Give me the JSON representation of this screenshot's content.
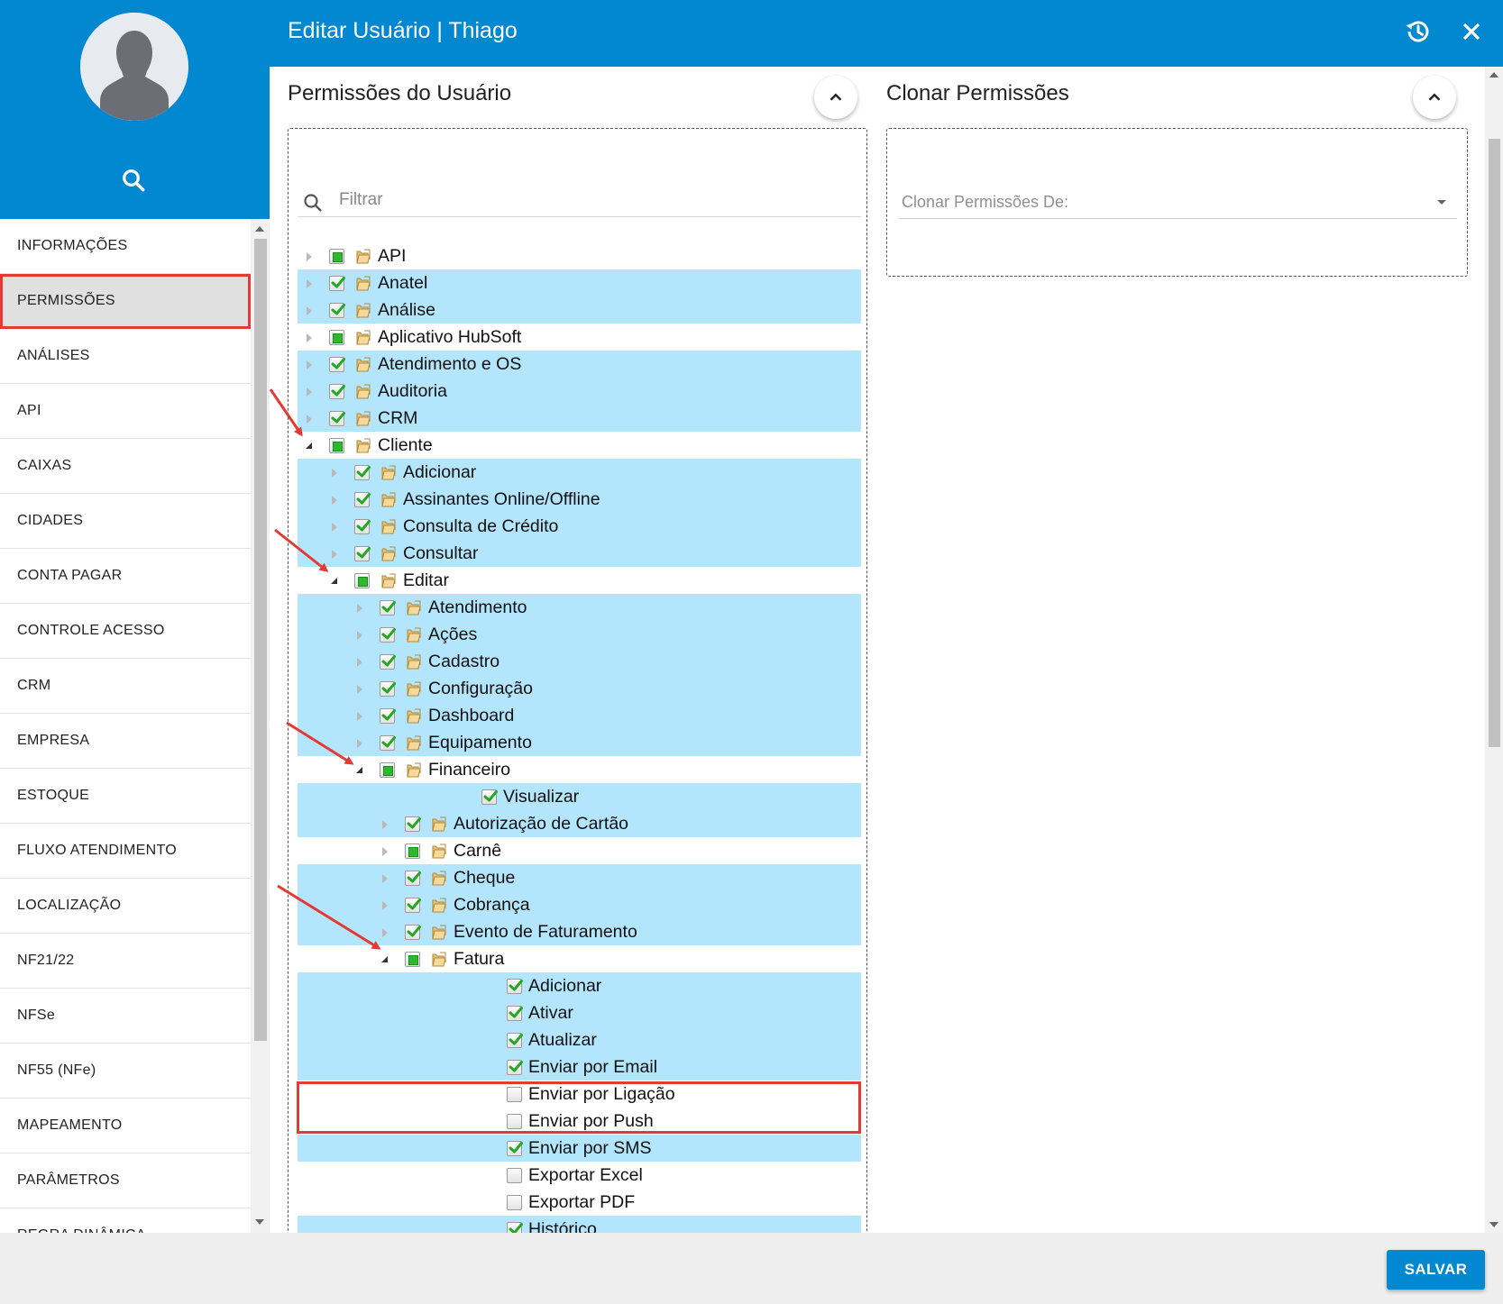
{
  "header": {
    "title": "Editar Usuário | Thiago"
  },
  "sidebar": {
    "items": [
      {
        "label": "INFORMAÇÕES",
        "active": false
      },
      {
        "label": "PERMISSÕES",
        "active": true
      },
      {
        "label": "ANÁLISES",
        "active": false
      },
      {
        "label": "API",
        "active": false
      },
      {
        "label": "CAIXAS",
        "active": false
      },
      {
        "label": "CIDADES",
        "active": false
      },
      {
        "label": "CONTA PAGAR",
        "active": false
      },
      {
        "label": "CONTROLE ACESSO",
        "active": false
      },
      {
        "label": "CRM",
        "active": false
      },
      {
        "label": "EMPRESA",
        "active": false
      },
      {
        "label": "ESTOQUE",
        "active": false
      },
      {
        "label": "FLUXO ATENDIMENTO",
        "active": false
      },
      {
        "label": "LOCALIZAÇÃO",
        "active": false
      },
      {
        "label": "NF21/22",
        "active": false
      },
      {
        "label": "NFSe",
        "active": false
      },
      {
        "label": "NF55 (NFe)",
        "active": false
      },
      {
        "label": "MAPEAMENTO",
        "active": false
      },
      {
        "label": "PARÂMETROS",
        "active": false
      },
      {
        "label": "REGRA DINÂMICA",
        "active": false
      }
    ]
  },
  "permissions": {
    "title": "Permissões do Usuário",
    "filter_placeholder": "Filtrar",
    "tree": [
      {
        "label": "API",
        "level": 0,
        "toggle": "closed",
        "check": "partial",
        "folder": true,
        "highlight": false
      },
      {
        "label": "Anatel",
        "level": 0,
        "toggle": "closed",
        "check": "checked",
        "folder": true,
        "highlight": true
      },
      {
        "label": "Análise",
        "level": 0,
        "toggle": "closed",
        "check": "checked",
        "folder": true,
        "highlight": true
      },
      {
        "label": "Aplicativo HubSoft",
        "level": 0,
        "toggle": "closed",
        "check": "partial",
        "folder": true,
        "highlight": false
      },
      {
        "label": "Atendimento e OS",
        "level": 0,
        "toggle": "closed",
        "check": "checked",
        "folder": true,
        "highlight": true
      },
      {
        "label": "Auditoria",
        "level": 0,
        "toggle": "closed",
        "check": "checked",
        "folder": true,
        "highlight": true
      },
      {
        "label": "CRM",
        "level": 0,
        "toggle": "closed",
        "check": "checked",
        "folder": true,
        "highlight": true
      },
      {
        "label": "Cliente",
        "level": 0,
        "toggle": "open",
        "check": "partial",
        "folder": true,
        "highlight": false
      },
      {
        "label": "Adicionar",
        "level": 1,
        "toggle": "closed",
        "check": "checked",
        "folder": true,
        "highlight": true
      },
      {
        "label": "Assinantes Online/Offline",
        "level": 1,
        "toggle": "closed",
        "check": "checked",
        "folder": true,
        "highlight": true
      },
      {
        "label": "Consulta de Crédito",
        "level": 1,
        "toggle": "closed",
        "check": "checked",
        "folder": true,
        "highlight": true
      },
      {
        "label": "Consultar",
        "level": 1,
        "toggle": "closed",
        "check": "checked",
        "folder": true,
        "highlight": true
      },
      {
        "label": "Editar",
        "level": 1,
        "toggle": "open",
        "check": "partial",
        "folder": true,
        "highlight": false
      },
      {
        "label": "Atendimento",
        "level": 2,
        "toggle": "closed",
        "check": "checked",
        "folder": true,
        "highlight": true
      },
      {
        "label": "Ações",
        "level": 2,
        "toggle": "closed",
        "check": "checked",
        "folder": true,
        "highlight": true
      },
      {
        "label": "Cadastro",
        "level": 2,
        "toggle": "closed",
        "check": "checked",
        "folder": true,
        "highlight": true
      },
      {
        "label": "Configuração",
        "level": 2,
        "toggle": "closed",
        "check": "checked",
        "folder": true,
        "highlight": true
      },
      {
        "label": "Dashboard",
        "level": 2,
        "toggle": "closed",
        "check": "checked",
        "folder": true,
        "highlight": true
      },
      {
        "label": "Equipamento",
        "level": 2,
        "toggle": "closed",
        "check": "checked",
        "folder": true,
        "highlight": true
      },
      {
        "label": "Financeiro",
        "level": 2,
        "toggle": "open",
        "check": "partial",
        "folder": true,
        "highlight": false
      },
      {
        "label": "Visualizar",
        "level": 3,
        "toggle": "none",
        "check": "checked",
        "folder": false,
        "highlight": true
      },
      {
        "label": "Autorização de Cartão",
        "level": 3,
        "toggle": "closed",
        "check": "checked",
        "folder": true,
        "highlight": true
      },
      {
        "label": "Carnê",
        "level": 3,
        "toggle": "closed",
        "check": "partial",
        "folder": true,
        "highlight": false
      },
      {
        "label": "Cheque",
        "level": 3,
        "toggle": "closed",
        "check": "checked",
        "folder": true,
        "highlight": true
      },
      {
        "label": "Cobrança",
        "level": 3,
        "toggle": "closed",
        "check": "checked",
        "folder": true,
        "highlight": true
      },
      {
        "label": "Evento de Faturamento",
        "level": 3,
        "toggle": "closed",
        "check": "checked",
        "folder": true,
        "highlight": true
      },
      {
        "label": "Fatura",
        "level": 3,
        "toggle": "open",
        "check": "partial",
        "folder": true,
        "highlight": false
      },
      {
        "label": "Adicionar",
        "level": 4,
        "toggle": "none",
        "check": "checked",
        "folder": false,
        "highlight": true
      },
      {
        "label": "Ativar",
        "level": 4,
        "toggle": "none",
        "check": "checked",
        "folder": false,
        "highlight": true
      },
      {
        "label": "Atualizar",
        "level": 4,
        "toggle": "none",
        "check": "checked",
        "folder": false,
        "highlight": true
      },
      {
        "label": "Enviar por Email",
        "level": 4,
        "toggle": "none",
        "check": "checked",
        "folder": false,
        "highlight": true
      },
      {
        "label": "Enviar por Ligação",
        "level": 4,
        "toggle": "none",
        "check": "unchecked",
        "folder": false,
        "highlight": false
      },
      {
        "label": "Enviar por Push",
        "level": 4,
        "toggle": "none",
        "check": "unchecked",
        "folder": false,
        "highlight": false
      },
      {
        "label": "Enviar por SMS",
        "level": 4,
        "toggle": "none",
        "check": "checked",
        "folder": false,
        "highlight": true
      },
      {
        "label": "Exportar Excel",
        "level": 4,
        "toggle": "none",
        "check": "unchecked",
        "folder": false,
        "highlight": false
      },
      {
        "label": "Exportar PDF",
        "level": 4,
        "toggle": "none",
        "check": "unchecked",
        "folder": false,
        "highlight": false
      },
      {
        "label": "Histórico",
        "level": 4,
        "toggle": "none",
        "check": "checked",
        "folder": false,
        "highlight": true
      }
    ]
  },
  "clone": {
    "title": "Clonar Permissões",
    "select_label": "Clonar Permissões De:"
  },
  "footer": {
    "save_label": "SALVAR"
  },
  "colors": {
    "primary": "#0288d1",
    "row_highlight": "#b3e5fc",
    "check_green": "#2db82d",
    "annotation_red": "#e53935"
  }
}
